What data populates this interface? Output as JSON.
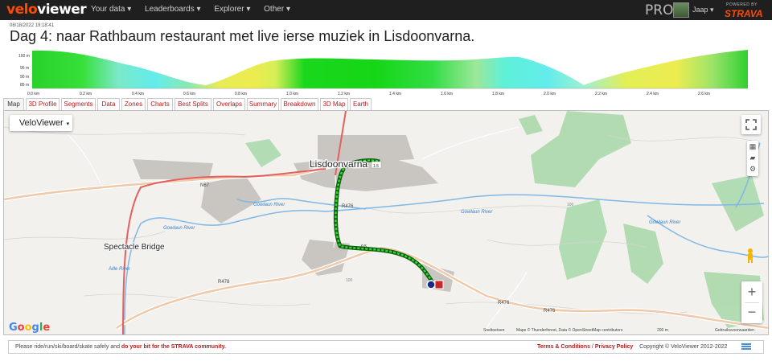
{
  "header": {
    "logo_part1": "velo",
    "logo_part2": "viewer",
    "nav": [
      "Your data ▾",
      "Leaderboards ▾",
      "Explorer ▾",
      "Other ▾"
    ],
    "pro_label": "PRO",
    "user_name": "Jaap ▾",
    "powered_by": "POWERED BY",
    "strava": "STRAVA"
  },
  "activity": {
    "timestamp": "08/18/2022 19:18:41",
    "title": "Dag 4: naar Rathbaum restaurant met live ierse muziek in Lisdoonvarna."
  },
  "elevation": {
    "y_ticks": [
      "100 m",
      "95 m",
      "90 m",
      "85 m"
    ],
    "x_ticks": [
      "0.0 km",
      "0.2 km",
      "0.4 km",
      "0.6 km",
      "0.8 km",
      "1.0 km",
      "1.2 km",
      "1.4 km",
      "1.6 km",
      "1.8 km",
      "2.0 km",
      "2.2 km",
      "2.4 km",
      "2.6 km"
    ]
  },
  "tabs": [
    {
      "label": "Map"
    },
    {
      "label": "3D Profile"
    },
    {
      "label": "Segments"
    },
    {
      "label": "Data"
    },
    {
      "label": "Zones"
    },
    {
      "label": "Charts"
    },
    {
      "label": "Best Splits"
    },
    {
      "label": "Overlaps"
    },
    {
      "label": "Summary"
    },
    {
      "label": "Breakdown"
    },
    {
      "label": "3D Map"
    },
    {
      "label": "Earth"
    }
  ],
  "map": {
    "layer_select": "VeloViewer",
    "labels": {
      "town": "Lisdoonvarna",
      "bridge": "Spectacle Bridge",
      "river1": "Gowlaun River",
      "river2": "Gowlaun River",
      "river3": "Gowlaun River",
      "river4": "Gowlaun River",
      "river5": "Aille River",
      "r478": "R478",
      "r476a": "R476",
      "r476b": "R476",
      "r476c": "R476",
      "n67": "N67",
      "m100": "100",
      "m100b": "100"
    },
    "route_markers": [
      "1.5",
      "0.5"
    ],
    "google": "Google",
    "attrib_shortcuts": "Sneltoetsen",
    "attrib_data": "Maps © Thunderforest, Data © OpenStreetMap contributors",
    "scale": "200 m",
    "terms": "Gebruiksvoorwaarden",
    "zoom_in": "+",
    "zoom_out": "−"
  },
  "footer": {
    "left_plain": "Please ride/run/ski/board/skate safely and ",
    "left_link": "do your bit for the STRAVA community.",
    "terms": "Terms & Conditions",
    "sep": " / ",
    "privacy": "Privacy Policy",
    "copyright": "Copyright © VeloViewer 2012-2022"
  }
}
